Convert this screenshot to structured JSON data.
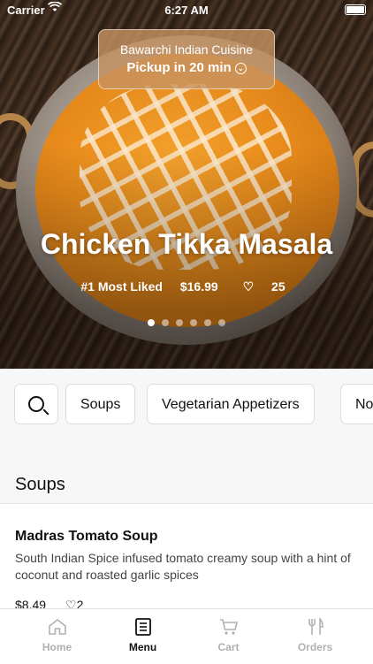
{
  "status_bar": {
    "carrier": "Carrier",
    "time": "6:27 AM"
  },
  "restaurant": {
    "name": "Bawarchi Indian Cuisine",
    "pickup": "Pickup in 20 min"
  },
  "featured": {
    "title": "Chicken Tikka Masala",
    "rank": "#1 Most Liked",
    "price": "$16.99",
    "likes": "25",
    "carousel_count": 6,
    "carousel_active": 1
  },
  "categories": [
    "Soups",
    "Vegetarian Appetizers",
    "No"
  ],
  "section": {
    "title": "Soups"
  },
  "menu_item": {
    "name": "Madras Tomato Soup",
    "description": "South Indian Spice infused tomato creamy soup with a hint of coconut and roasted garlic spices",
    "price": "$8.49",
    "likes": "2"
  },
  "tabs": [
    {
      "label": "Home",
      "icon": "home-icon",
      "active": false
    },
    {
      "label": "Menu",
      "icon": "menu-icon",
      "active": true
    },
    {
      "label": "Cart",
      "icon": "cart-icon",
      "active": false
    },
    {
      "label": "Orders",
      "icon": "utensils-icon",
      "active": false
    }
  ],
  "colors": {
    "accent_card": "#c79362",
    "active_tab": "#111111",
    "inactive_tab": "#b0b0b0"
  }
}
